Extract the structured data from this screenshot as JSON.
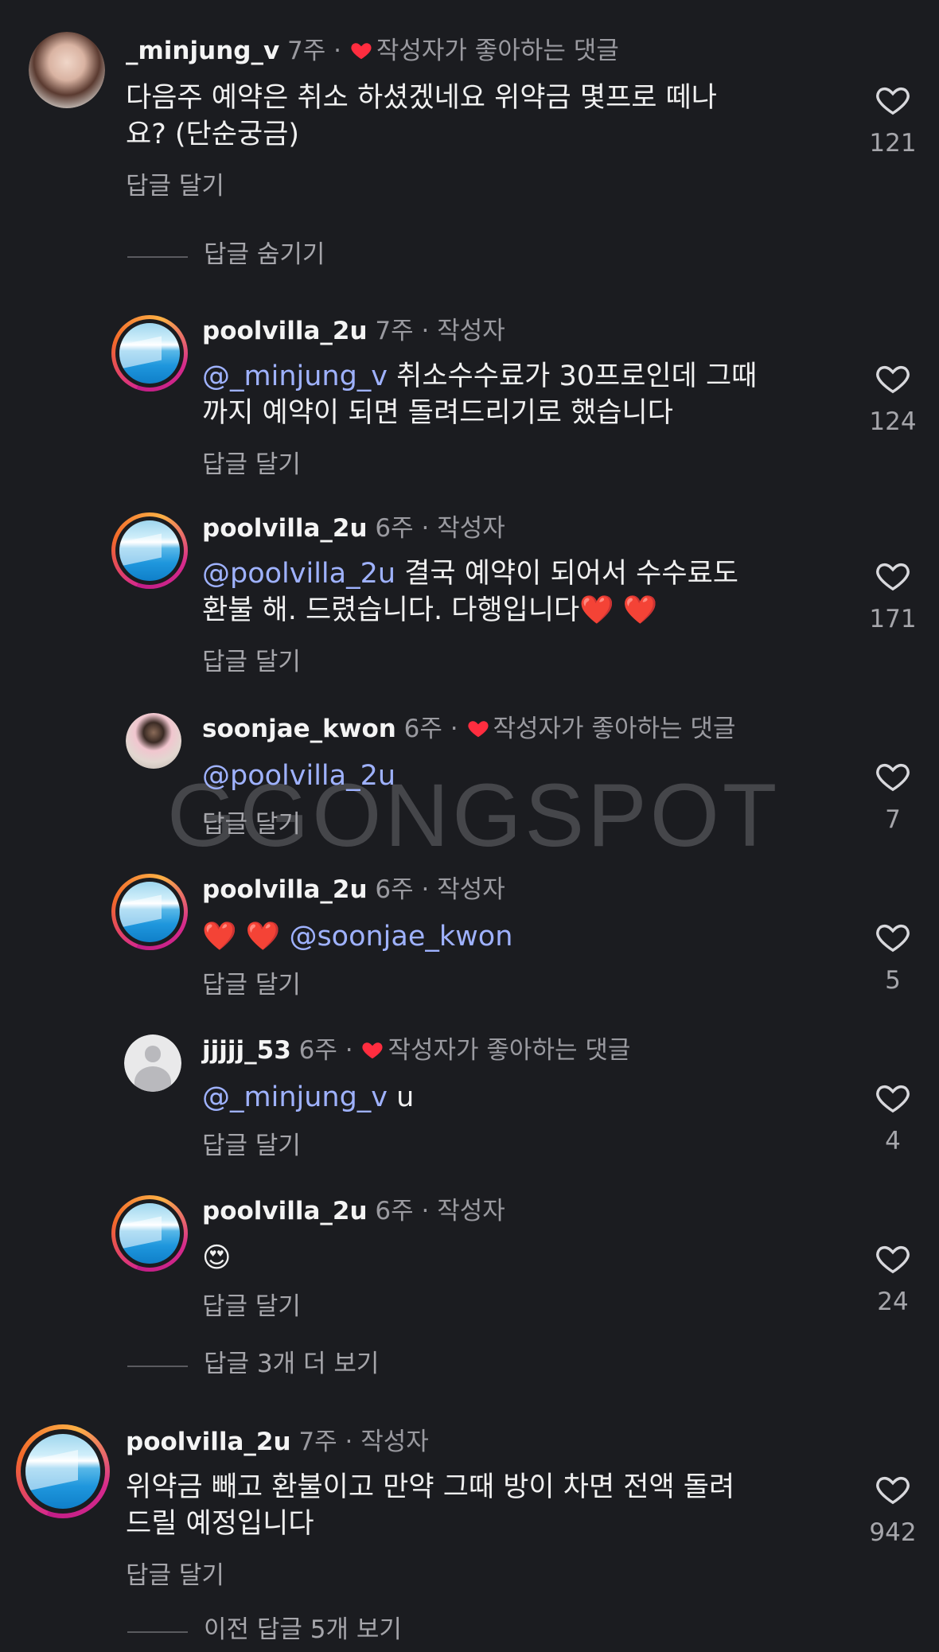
{
  "watermark": "GGONGSPOT",
  "colors": {
    "background": "#1b1c20",
    "mention": "#9fb2ff",
    "heart_red": "#ff2d3f",
    "ring_start": "#d62a8c",
    "ring_end": "#fcb045"
  },
  "comments": [
    {
      "username": "_minjung_v",
      "time": "7주",
      "dot": "·",
      "liked_by_author_label": "작성자가 좋아하는 댓글",
      "text_line1": "다음주 예약은 취소 하셨겠네요 위약금 몇프로 떼나",
      "text_line2": "요? (단순궁금)",
      "reply_label": "답글 달기",
      "likes": "121",
      "avatar_icon": "user-avatar"
    },
    {
      "username": "poolvilla_2u",
      "time": "7주",
      "dot": "·",
      "author_tag": "작성자",
      "mention": "@_minjung_v",
      "text_line1": " 취소수수료가 30프로인데 그때",
      "text_line2": "까지 예약이 되면 돌려드리기로 했습니다",
      "reply_label": "답글 달기",
      "likes": "124"
    },
    {
      "username": "poolvilla_2u",
      "time": "6주",
      "dot": "·",
      "author_tag": "작성자",
      "mention": "@poolvilla_2u",
      "text_line1": " 결국 예약이 되어서 수수료도",
      "text_line2": "환불 해. 드렸습니다. 다행입니다❤️ ❤️",
      "reply_label": "답글 달기",
      "likes": "171"
    },
    {
      "username": "soonjae_kwon",
      "time": "6주",
      "dot": "·",
      "liked_by_author_label": "작성자가 좋아하는 댓글",
      "mention": "@poolvilla_2u",
      "reply_label": "답글 달기",
      "likes": "7"
    },
    {
      "username": "poolvilla_2u",
      "time": "6주",
      "dot": "·",
      "author_tag": "작성자",
      "emoji": "❤️ ❤️",
      "mention": "@soonjae_kwon",
      "reply_label": "답글 달기",
      "likes": "5"
    },
    {
      "username": "jjjjj_53",
      "time": "6주",
      "dot": "·",
      "liked_by_author_label": "작성자가 좋아하는 댓글",
      "mention": "@_minjung_v",
      "text_line1": " u",
      "reply_label": "답글 달기",
      "likes": "4"
    },
    {
      "username": "poolvilla_2u",
      "time": "6주",
      "dot": "·",
      "author_tag": "작성자",
      "emoji": "😍",
      "reply_label": "답글 달기",
      "likes": "24"
    },
    {
      "username": "poolvilla_2u",
      "time": "7주",
      "dot": "·",
      "author_tag": "작성자",
      "text_line1": "위약금 빼고 환불이고 만약 그때 방이 차면 전액 돌려",
      "text_line2": "드릴 예정입니다",
      "reply_label": "답글 달기",
      "likes": "942"
    }
  ],
  "thread_controls": {
    "hide_replies": "답글 숨기기",
    "more_replies": "답글 3개 더 보기",
    "previous_replies": "이전 답글 5개 보기"
  }
}
